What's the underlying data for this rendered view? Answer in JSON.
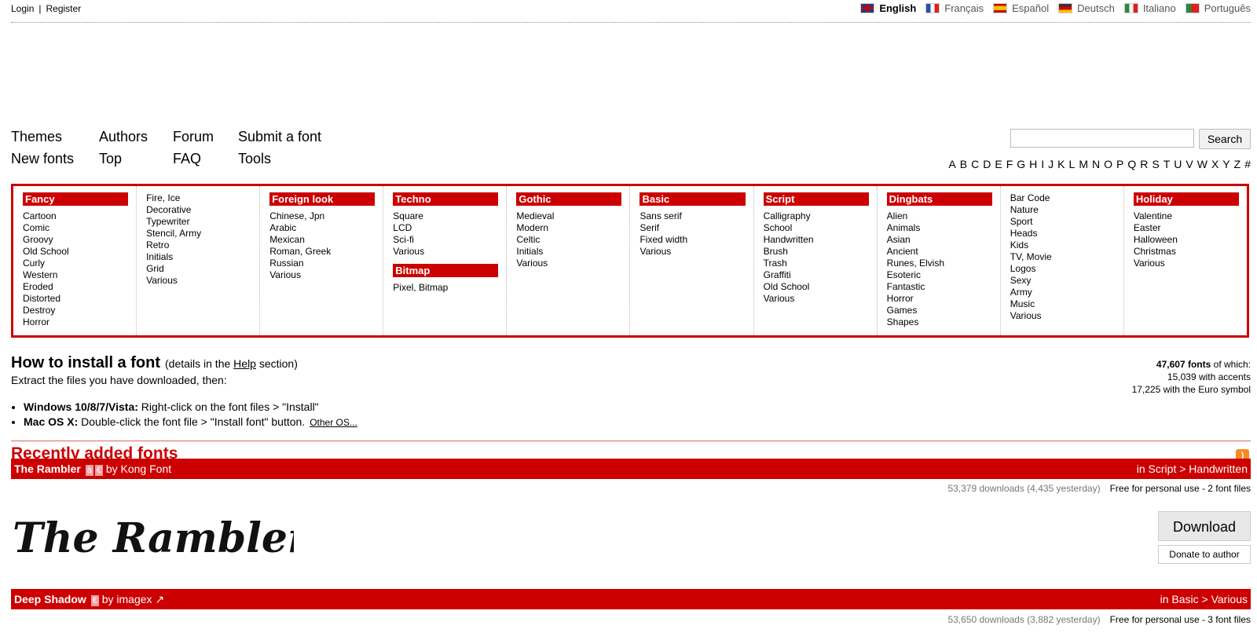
{
  "topbar": {
    "login": "Login",
    "separator": "|",
    "register": "Register",
    "languages": [
      {
        "label": "English",
        "active": true
      },
      {
        "label": "Français",
        "active": false
      },
      {
        "label": "Español",
        "active": false
      },
      {
        "label": "Deutsch",
        "active": false
      },
      {
        "label": "Italiano",
        "active": false
      },
      {
        "label": "Português",
        "active": false
      }
    ]
  },
  "nav": {
    "themes": "Themes",
    "authors": "Authors",
    "forum": "Forum",
    "submit": "Submit a font",
    "new_fonts": "New fonts",
    "top": "Top",
    "faq": "FAQ",
    "tools": "Tools"
  },
  "search": {
    "placeholder": "",
    "button": "Search"
  },
  "alphabet": [
    "A",
    "B",
    "C",
    "D",
    "E",
    "F",
    "G",
    "H",
    "I",
    "J",
    "K",
    "L",
    "M",
    "N",
    "O",
    "P",
    "Q",
    "R",
    "S",
    "T",
    "U",
    "V",
    "W",
    "X",
    "Y",
    "Z",
    "#"
  ],
  "categories": {
    "fancy": {
      "title": "Fancy",
      "items": [
        "Cartoon",
        "Comic",
        "Groovy",
        "Old School",
        "Curly",
        "Western",
        "Eroded",
        "Distorted",
        "Destroy",
        "Horror"
      ]
    },
    "fancy2": {
      "items": [
        "Fire, Ice",
        "Decorative",
        "Typewriter",
        "Stencil, Army",
        "Retro",
        "Initials",
        "Grid",
        "Various"
      ]
    },
    "foreign": {
      "title": "Foreign look",
      "items": [
        "Chinese, Jpn",
        "Arabic",
        "Mexican",
        "Roman, Greek",
        "Russian",
        "Various"
      ]
    },
    "techno": {
      "title": "Techno",
      "items": [
        "Square",
        "LCD",
        "Sci-fi",
        "Various"
      ]
    },
    "bitmap": {
      "title": "Bitmap",
      "items": [
        "Pixel, Bitmap"
      ]
    },
    "gothic": {
      "title": "Gothic",
      "items": [
        "Medieval",
        "Modern",
        "Celtic",
        "Initials",
        "Various"
      ]
    },
    "basic": {
      "title": "Basic",
      "items": [
        "Sans serif",
        "Serif",
        "Fixed width",
        "Various"
      ]
    },
    "script": {
      "title": "Script",
      "items": [
        "Calligraphy",
        "School",
        "Handwritten",
        "Brush",
        "Trash",
        "Graffiti",
        "Old School",
        "Various"
      ]
    },
    "dingbats": {
      "title": "Dingbats",
      "items": [
        "Alien",
        "Animals",
        "Asian",
        "Ancient",
        "Runes, Elvish",
        "Esoteric",
        "Fantastic",
        "Horror",
        "Games",
        "Shapes"
      ]
    },
    "dingbats2": {
      "items": [
        "Bar Code",
        "Nature",
        "Sport",
        "Heads",
        "Kids",
        "TV, Movie",
        "Logos",
        "Sexy",
        "Army",
        "Music",
        "Various"
      ]
    },
    "holiday": {
      "title": "Holiday",
      "items": [
        "Valentine",
        "Easter",
        "Halloween",
        "Christmas",
        "Various"
      ]
    }
  },
  "install": {
    "title": "How to install a font",
    "details_prefix": "(details in the",
    "details_link": "Help",
    "details_suffix": "section)",
    "extract": "Extract the files you have downloaded, then:",
    "win_label": "Windows 10/8/7/Vista:",
    "win_text": "Right-click on the font files > \"Install\"",
    "mac_label": "Mac OS X:",
    "mac_text": "Double-click the font file > \"Install font\" button.",
    "other_os": "Other OS..."
  },
  "stats": {
    "count": "47,607 fonts",
    "of_which": "of which:",
    "accents": "15,039 with accents",
    "euro": "17,225 with the Euro symbol"
  },
  "recent": {
    "title": "Recently added fonts"
  },
  "fonts": [
    {
      "name": "The Rambler",
      "badges": [
        "à",
        "€"
      ],
      "author": "by Kong Font",
      "category": "in Script > Handwritten",
      "downloads": "53,379 downloads (4,435 yesterday)",
      "license": "Free for personal use - 2 font files",
      "preview_text": "The Rambler",
      "download_label": "Download",
      "donate_label": "Donate to author"
    },
    {
      "name": "Deep Shadow",
      "badges": [
        "€"
      ],
      "author": "by imagex",
      "category": "in Basic > Various",
      "downloads": "53,650 downloads (3,882 yesterday)",
      "license": "Free for personal use - 3 font files"
    }
  ],
  "colors": {
    "accent": "#cc0000"
  }
}
